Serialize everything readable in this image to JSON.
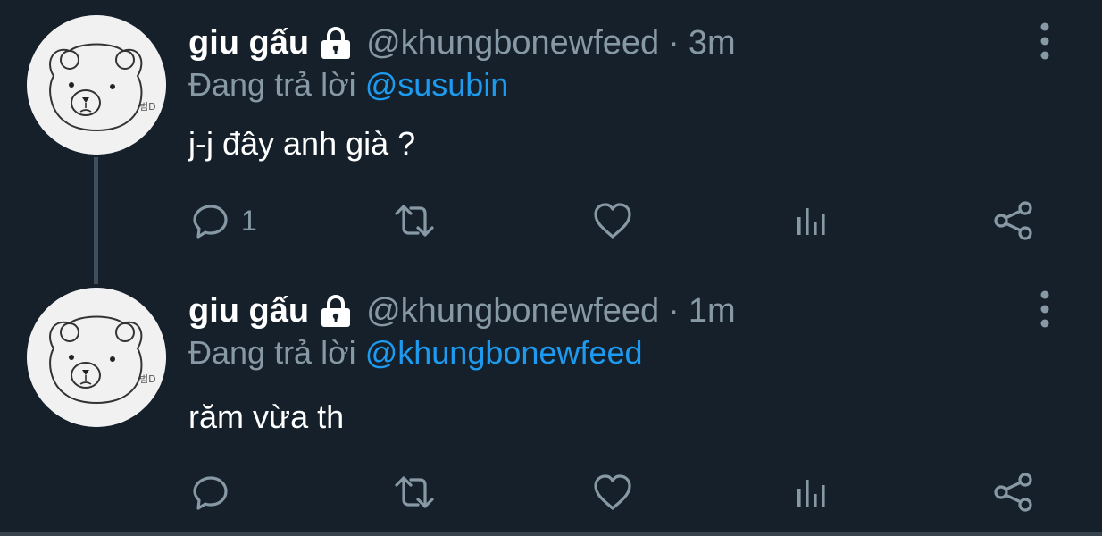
{
  "colors": {
    "background": "#15202b",
    "primary_text": "#ffffff",
    "secondary_text": "#8899a6",
    "link": "#1d9bf0",
    "thread_line": "#3d4f5f"
  },
  "tweets": [
    {
      "display_name": "giu gấu",
      "handle": "@khungbonewfeed",
      "separator": "·",
      "time": "3m",
      "reply_prefix": "Đang trả lời",
      "reply_to": "@susubin",
      "text": "j-j đây anh già ?",
      "reply_count": "1",
      "avatar_caption": "범D",
      "icons": {
        "lock": "lock-icon",
        "more": "more-vertical-icon",
        "reply": "reply-icon",
        "retweet": "retweet-icon",
        "like": "heart-icon",
        "analytics": "analytics-icon",
        "share": "share-icon"
      }
    },
    {
      "display_name": "giu gấu",
      "handle": "@khungbonewfeed",
      "separator": "·",
      "time": "1m",
      "reply_prefix": "Đang trả lời",
      "reply_to": "@khungbonewfeed",
      "text": "răm vừa th",
      "reply_count": "",
      "avatar_caption": "범D",
      "icons": {
        "lock": "lock-icon",
        "more": "more-vertical-icon",
        "reply": "reply-icon",
        "retweet": "retweet-icon",
        "like": "heart-icon",
        "analytics": "analytics-icon",
        "share": "share-icon"
      }
    }
  ]
}
